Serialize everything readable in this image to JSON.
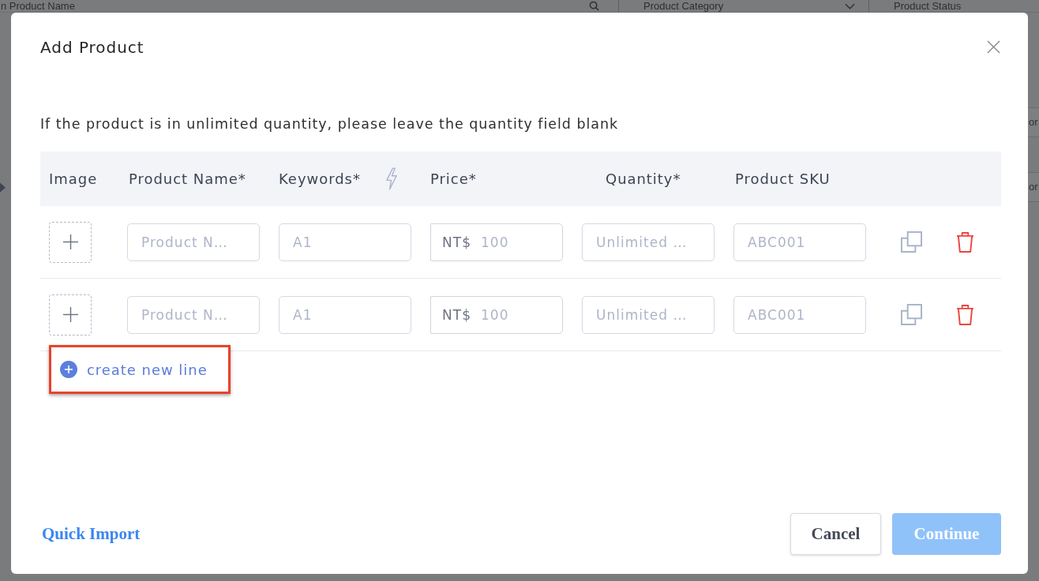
{
  "background": {
    "search_field": {
      "placeholder": "n Product Name"
    },
    "filters": [
      {
        "label": "Product Category"
      },
      {
        "label": "Product Status"
      }
    ],
    "side_buttons": [
      {
        "label": "or"
      },
      {
        "label": "or"
      }
    ]
  },
  "dialog": {
    "title": "Add Product",
    "note": "If the product is in unlimited quantity, please leave the quantity field blank",
    "table": {
      "columns": [
        {
          "label": "Image"
        },
        {
          "label": "Product Name*"
        },
        {
          "label": "Keywords*"
        },
        {
          "label": "Price*"
        },
        {
          "label": "Quantity*"
        },
        {
          "label": "Product SKU"
        }
      ],
      "rows": [
        {
          "name": {
            "placeholder": "Product N…"
          },
          "keywords": {
            "placeholder": "A1"
          },
          "price": {
            "prefix": "NT$",
            "placeholder": "100"
          },
          "quantity": {
            "placeholder": "Unlimited …"
          },
          "sku": {
            "placeholder": "ABC001"
          }
        },
        {
          "name": {
            "placeholder": "Product N…"
          },
          "keywords": {
            "placeholder": "A1"
          },
          "price": {
            "prefix": "NT$",
            "placeholder": "100"
          },
          "quantity": {
            "placeholder": "Unlimited …"
          },
          "sku": {
            "placeholder": "ABC001"
          }
        }
      ]
    },
    "add_line": {
      "label": "create new line",
      "highlighted": true
    },
    "quick_import": {
      "label": "Quick Import"
    },
    "buttons": [
      {
        "label": "Cancel",
        "kind": "secondary",
        "disabled": false
      },
      {
        "label": "Continue",
        "kind": "primary",
        "disabled": true
      }
    ]
  }
}
